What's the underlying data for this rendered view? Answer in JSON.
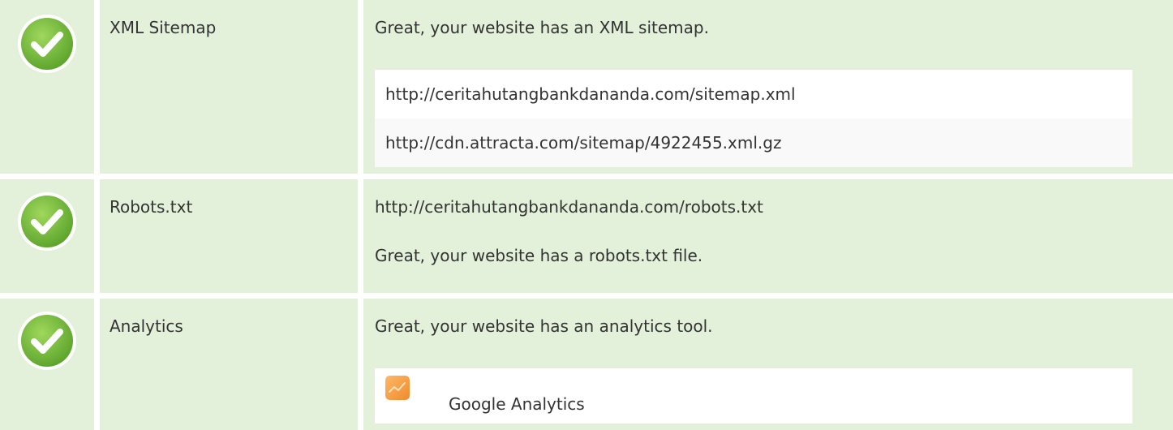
{
  "rows": [
    {
      "label": "XML Sitemap",
      "message": "Great, your website has an XML sitemap.",
      "sitemaps": [
        "http://ceritahutangbankdananda.com/sitemap.xml",
        "http://cdn.attracta.com/sitemap/4922455.xml.gz"
      ],
      "status": "pass"
    },
    {
      "label": "Robots.txt",
      "url": "http://ceritahutangbankdananda.com/robots.txt",
      "message": "Great, your website has a robots.txt file.",
      "status": "pass"
    },
    {
      "label": "Analytics",
      "message": "Great, your website has an analytics tool.",
      "tools": [
        "Google Analytics"
      ],
      "status": "pass"
    }
  ],
  "colors": {
    "row_background": "#e3f1da",
    "check_green": "#7cc242",
    "analytics_orange": "#f4a04a"
  },
  "icons": {
    "status": "check-circle-icon",
    "analytics_tool": "google-analytics-icon"
  }
}
